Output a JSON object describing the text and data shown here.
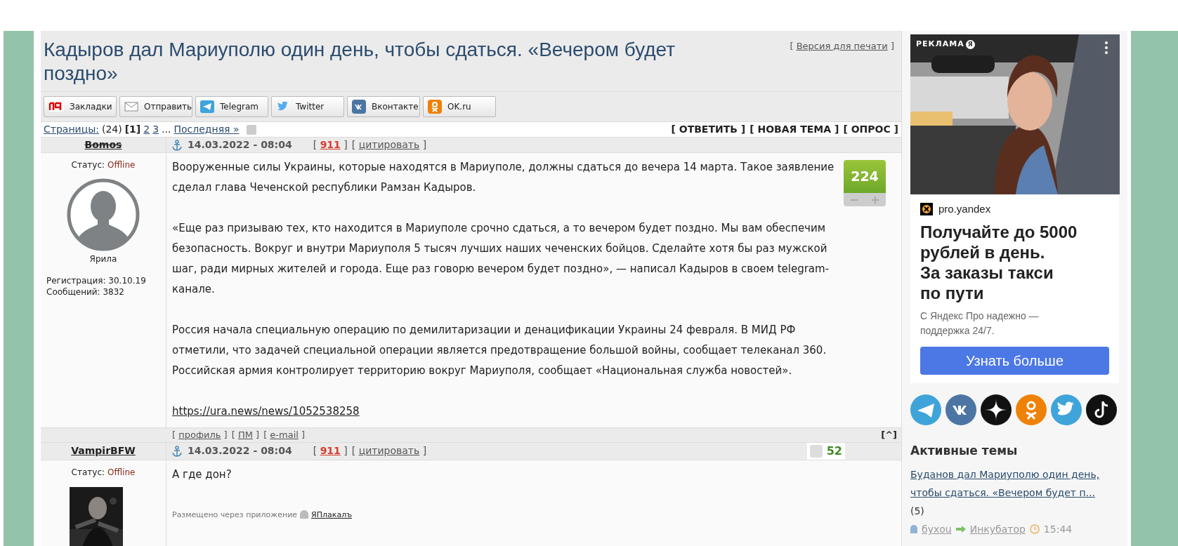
{
  "topic": {
    "title": "Кадыров дал Мариуполю один день, чтобы сдаться. «Вечером будет поздно»",
    "print_link": {
      "open": "[",
      "text": "Версия для печати",
      "close": "]"
    }
  },
  "share_buttons": [
    {
      "kind": "yap",
      "label": "Закладки"
    },
    {
      "kind": "mail",
      "label": "Отправить"
    },
    {
      "kind": "telegram",
      "label": "Telegram"
    },
    {
      "kind": "twitter",
      "label": "Twitter"
    },
    {
      "kind": "vk",
      "label": "Вконтакте"
    },
    {
      "kind": "ok",
      "label": "OK.ru"
    }
  ],
  "pagination": {
    "label": "Страницы:",
    "count": "(24)",
    "pages": [
      {
        "label": "[1]",
        "selected": true
      },
      {
        "label": "2",
        "selected": false
      },
      {
        "label": "3",
        "selected": false
      }
    ],
    "ellipsis": "...",
    "last": "Последняя »"
  },
  "actions": [
    "[ ОТВЕТИТЬ ]",
    "[ НОВАЯ ТЕМА ]",
    "[ ОПРОС ]"
  ],
  "posts": [
    {
      "author": "Bomos",
      "struck": true,
      "status_label": "Статус:",
      "status": "Offline",
      "avatar": {
        "kind": "silhouette"
      },
      "rank": "Ярила",
      "registration": "Регистрация: 30.10.19",
      "messages": "Сообщений: 3832",
      "date": "14.03.2022 - 08:04",
      "number": {
        "open": "[",
        "text": "911",
        "close": "]"
      },
      "quote": {
        "open": "[",
        "text": "цитировать",
        "close": "]"
      },
      "rating": {
        "kind": "badge",
        "value": "224"
      },
      "paragraphs": [
        "Вооруженные силы Украины, которые находятся в Мариуполе, должны сдаться до вечера 14 марта. Такое заявление сделал глава Чеченской республики Рамзан Кадыров.",
        "«Еще раз призываю тех, кто находится в Мариуполе срочно сдаться, а то вечером будет поздно. Мы вам обеспечим безопасность. Вокруг и внутри Мариуполя 5 тысяч лучших наших чеченских бойцов. Сделайте хотя бы раз мужской шаг, ради мирных жителей и города. Еще раз говорю вечером будет поздно», — написал Кадыров в своем telegram-канале.",
        "Россия начала специальную операцию по демилитаризации и денацификации Украины 24 февраля. В МИД РФ отметили, что задачей специальной операции является предотвращение большой войны, сообщает телеканал 360. Российская армия контролирует территорию вокруг Мариуполя, сообщает «Национальная служба новостей»."
      ],
      "link": "https://ura.news/news/1052538258",
      "footer_links": [
        {
          "open": "[",
          "text": "профиль",
          "close": "]"
        },
        {
          "open": "[",
          "text": "ПМ",
          "close": "]"
        },
        {
          "open": "[",
          "text": "e-mail",
          "close": "]"
        }
      ],
      "top_link": "[^]"
    },
    {
      "author": "VampirBFW",
      "struck": false,
      "status_label": "Статус:",
      "status": "Offline",
      "avatar": {
        "kind": "picture"
      },
      "date": "14.03.2022 - 08:04",
      "number": {
        "open": "[",
        "text": "911",
        "close": "]"
      },
      "quote": {
        "open": "[",
        "text": "цитировать",
        "close": "]"
      },
      "rating": {
        "kind": "inline",
        "value": "52"
      },
      "paragraphs": [
        "А где дон?"
      ],
      "via": "Размещено через приложение",
      "app": "ЯПлакалъ"
    }
  ],
  "ad": {
    "label": "РЕКЛАМА",
    "badge": "Я",
    "domain": "pro.yandex",
    "headline": [
      "Получайте до 5000",
      "рублей в день.",
      "За заказы такси",
      "по пути"
    ],
    "subtitle": "С Яндекс Про надежно — поддержка 24/7.",
    "button": "Узнать больше"
  },
  "socials": [
    {
      "kind": "telegram"
    },
    {
      "kind": "vk"
    },
    {
      "kind": "star"
    },
    {
      "kind": "ok"
    },
    {
      "kind": "twitter"
    },
    {
      "kind": "tiktok"
    }
  ],
  "active_topics": {
    "heading": "Активные темы",
    "items": [
      {
        "title": "Буданов дал Мариуполю один день, чтобы сдаться. «Вечером будет п...",
        "count": "(5)",
        "author": "бухоu",
        "section": "Инкубатор",
        "time": "15:44"
      }
    ]
  }
}
